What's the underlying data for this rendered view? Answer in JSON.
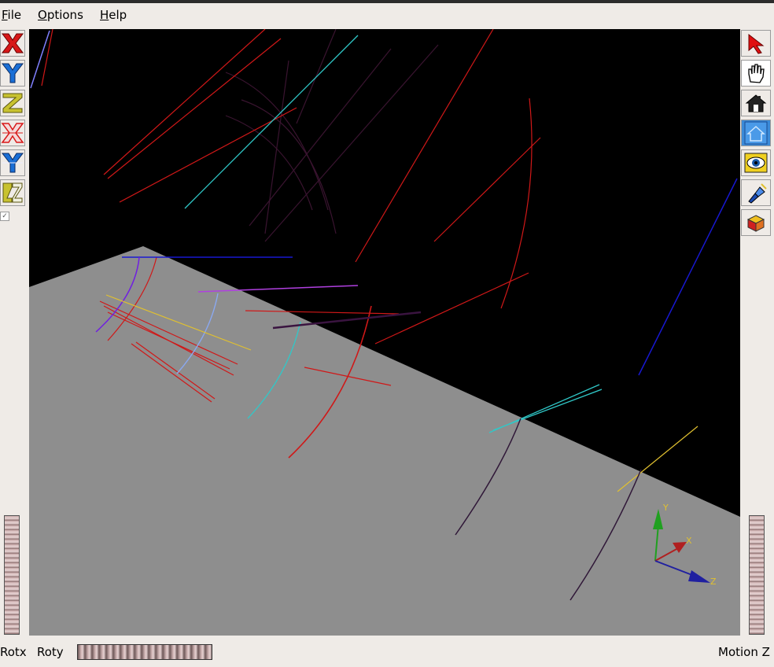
{
  "menu": {
    "file": "File",
    "file_rest": "ile",
    "file_mnemonic": "F",
    "options": "Options",
    "options_mnemonic": "O",
    "options_rest": "ptions",
    "help": "Help",
    "help_mnemonic": "H",
    "help_rest": "elp"
  },
  "left_toolbar": {
    "items": [
      {
        "icon": "x-axis-icon",
        "letter": "X",
        "color": "#d81818"
      },
      {
        "icon": "y-axis-icon",
        "letter": "Y",
        "color": "#1a6fd6"
      },
      {
        "icon": "z-axis-icon",
        "letter": "Z",
        "color": "#c8c230"
      },
      {
        "icon": "x-axis-reverse-icon",
        "letter": "X",
        "color": "#d81818"
      },
      {
        "icon": "y-axis-reverse-icon",
        "letter": "Y",
        "color": "#1a6fd6"
      },
      {
        "icon": "z-axis-reverse-icon",
        "letter": "Z",
        "color": "#c8c230"
      }
    ]
  },
  "right_toolbar": {
    "items": [
      {
        "icon": "select-arrow-icon"
      },
      {
        "icon": "pan-hand-icon"
      },
      {
        "icon": "home-icon"
      },
      {
        "icon": "set-home-icon"
      },
      {
        "icon": "view-all-eye-icon"
      },
      {
        "icon": "seek-flashlight-icon"
      },
      {
        "icon": "projection-cube-icon"
      }
    ]
  },
  "viewer": {
    "axes": {
      "x": "X",
      "y": "Y",
      "z": "Z"
    },
    "colors": {
      "background": "#000000",
      "plane": "#8e8e8e"
    }
  },
  "bottom": {
    "rotx": "Rotx",
    "roty": "Roty",
    "motion": "Motion Z"
  }
}
